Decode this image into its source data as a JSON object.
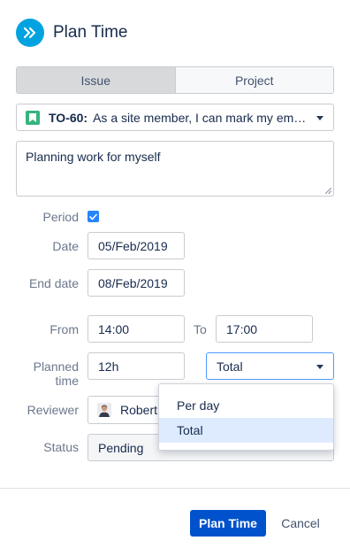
{
  "header": {
    "title": "Plan Time",
    "icon": "double-chevron-right-icon",
    "icon_color": "#00a3e0"
  },
  "tabs": [
    {
      "label": "Issue",
      "active": true
    },
    {
      "label": "Project",
      "active": false
    }
  ],
  "issue": {
    "key": "TO-60:",
    "summary": "As a site member, I can mark my em…",
    "type_icon": "story-bookmark-icon",
    "type_color": "#36b37e"
  },
  "description": {
    "value": "Planning work for myself"
  },
  "form": {
    "period": {
      "label": "Period",
      "checked": true
    },
    "date": {
      "label": "Date",
      "value": "05/Feb/2019"
    },
    "end_date": {
      "label": "End date",
      "value": "08/Feb/2019"
    },
    "from": {
      "label": "From",
      "value": "14:00"
    },
    "to": {
      "label": "To",
      "value": "17:00"
    },
    "planned_time": {
      "label_line1": "Planned",
      "label_line2": "time",
      "value": "12h",
      "type_value": "Total"
    },
    "reviewer": {
      "label": "Reviewer",
      "name": "Robert"
    },
    "status": {
      "label": "Status",
      "value": "Pending"
    }
  },
  "dropdown": {
    "options": [
      {
        "label": "Per day",
        "selected": false
      },
      {
        "label": "Total",
        "selected": true
      }
    ]
  },
  "footer": {
    "primary_label": "Plan Time",
    "cancel_label": "Cancel",
    "primary_color": "#0052cc"
  }
}
